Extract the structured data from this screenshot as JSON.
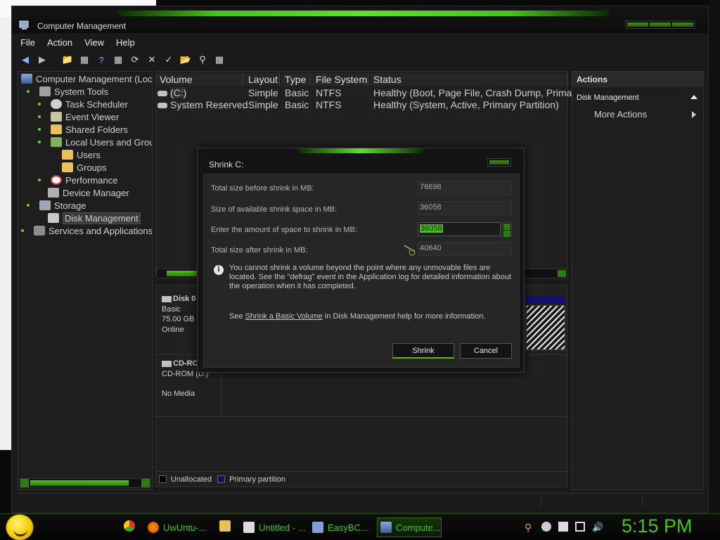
{
  "window": {
    "title": "Computer Management"
  },
  "menu": [
    "File",
    "Action",
    "View",
    "Help"
  ],
  "tree": {
    "items": [
      {
        "label": "Computer Management (Loc",
        "icon": "computer-management-icon"
      },
      {
        "label": "System Tools",
        "icon": "system-tools-icon"
      },
      {
        "label": "Task Scheduler",
        "icon": "clock-icon"
      },
      {
        "label": "Event Viewer",
        "icon": "event-viewer-icon"
      },
      {
        "label": "Shared Folders",
        "icon": "shared-folders-icon"
      },
      {
        "label": "Local Users and Grou",
        "icon": "users-icon"
      },
      {
        "label": "Users",
        "icon": "folder-icon"
      },
      {
        "label": "Groups",
        "icon": "folder-icon"
      },
      {
        "label": "Performance",
        "icon": "performance-icon"
      },
      {
        "label": "Device Manager",
        "icon": "device-manager-icon"
      },
      {
        "label": "Storage",
        "icon": "storage-icon"
      },
      {
        "label": "Disk Management",
        "icon": "disk-icon",
        "selected": true
      },
      {
        "label": "Services and Applications",
        "icon": "services-icon"
      }
    ]
  },
  "volumes": {
    "columns": [
      "Volume",
      "Layout",
      "Type",
      "File System",
      "Status"
    ],
    "rows": [
      {
        "volume": "(C:)",
        "layout": "Simple",
        "type": "Basic",
        "fs": "NTFS",
        "status": "Healthy (Boot, Page File, Crash Dump, Primary"
      },
      {
        "volume": "System Reserved",
        "layout": "Simple",
        "type": "Basic",
        "fs": "NTFS",
        "status": "Healthy (System, Active, Primary Partition)"
      }
    ]
  },
  "disks": {
    "disk0": {
      "name": "Disk 0",
      "type": "Basic",
      "size": "75.00 GB",
      "state": "Online"
    },
    "cdrom": {
      "name": "CD-RO",
      "type": "CD-ROM (D:)",
      "state": "No Media"
    }
  },
  "legend": {
    "unallocated": "Unallocated",
    "primary": "Primary partition"
  },
  "actions": {
    "header": "Actions",
    "section": "Disk Management",
    "more": "More Actions"
  },
  "dialog": {
    "title": "Shrink C:",
    "fields": [
      {
        "label": "Total size before shrink in MB:",
        "value": "76698"
      },
      {
        "label": "Size of available shrink space in MB:",
        "value": "36058"
      },
      {
        "label": "Enter the amount of space to shrink in MB:",
        "value": "36058"
      },
      {
        "label": "Total size after shrink in MB:",
        "value": "40640"
      }
    ],
    "info": "You cannot shrink a volume beyond the point where any unmovable files are located. See the \"defrag\" event in the Application log for detailed information about the operation when it has completed.",
    "see_prefix": "See",
    "see_link": "Shrink a Basic Volume",
    "see_suffix": "in Disk Management help for more information.",
    "shrink_button": "Shrink",
    "cancel_button": "Cancel"
  },
  "taskbar": {
    "tasks": [
      "UwUntu-...",
      "Untitled - ...",
      "EasyBC...",
      "Compute..."
    ],
    "clock": "5:15 PM"
  },
  "colors": {
    "accent": "#47c21b",
    "primary_partition": "#101070"
  }
}
